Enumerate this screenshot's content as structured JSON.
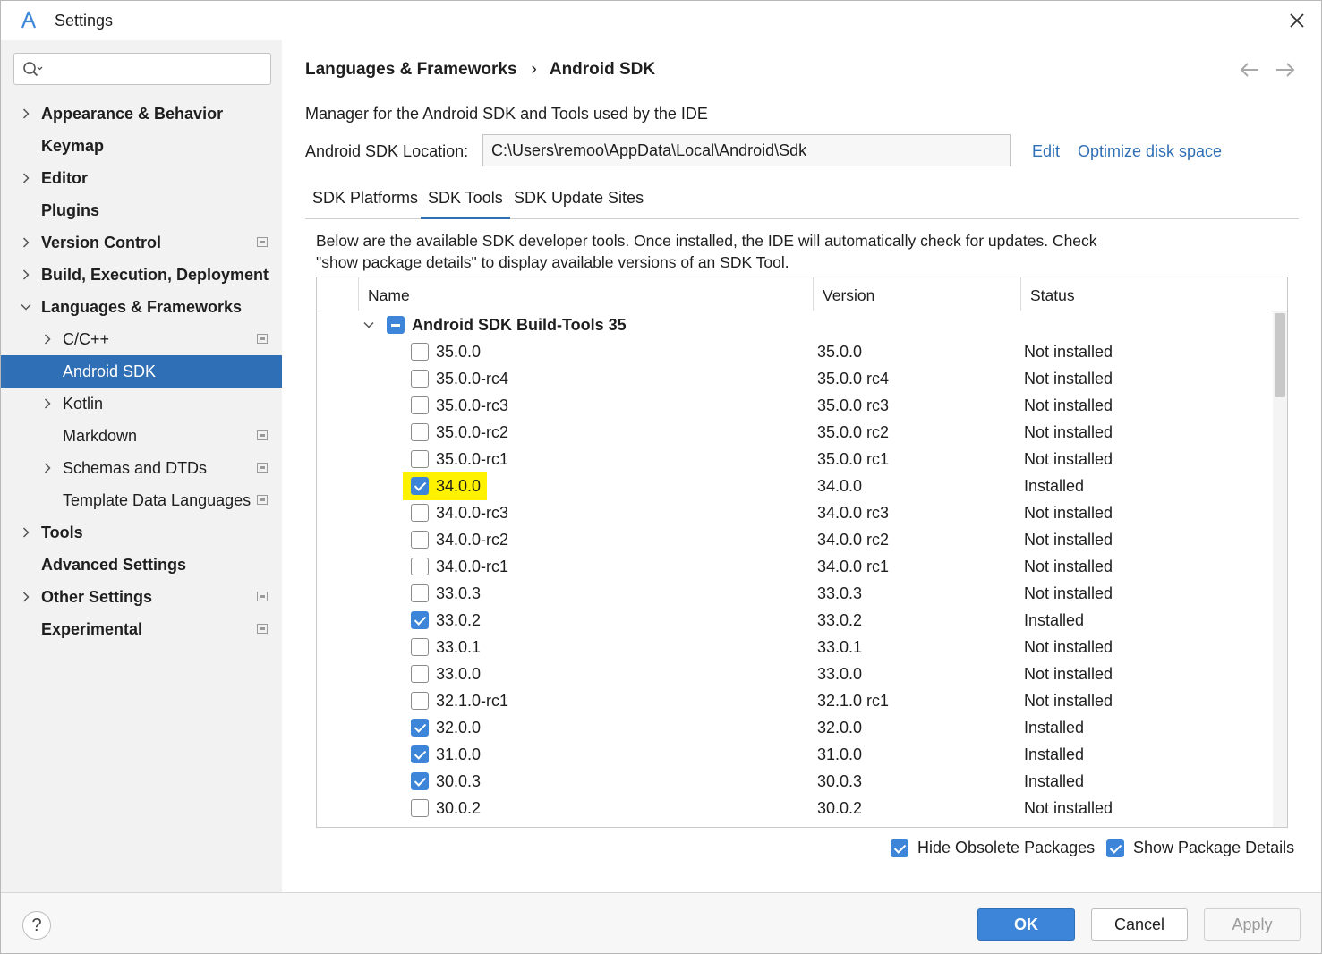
{
  "window": {
    "title": "Settings"
  },
  "search": {
    "placeholder": "",
    "value": ""
  },
  "sidebar": {
    "items": [
      {
        "label": "Appearance & Behavior",
        "bold": true,
        "chevron": "right",
        "level": 0,
        "project": false
      },
      {
        "label": "Keymap",
        "bold": true,
        "chevron": "none",
        "level": 0,
        "project": false
      },
      {
        "label": "Editor",
        "bold": true,
        "chevron": "right",
        "level": 0,
        "project": false
      },
      {
        "label": "Plugins",
        "bold": true,
        "chevron": "none",
        "level": 0,
        "project": false
      },
      {
        "label": "Version Control",
        "bold": true,
        "chevron": "right",
        "level": 0,
        "project": true
      },
      {
        "label": "Build, Execution, Deployment",
        "bold": true,
        "chevron": "right",
        "level": 0,
        "project": false
      },
      {
        "label": "Languages & Frameworks",
        "bold": true,
        "chevron": "down",
        "level": 0,
        "project": false
      },
      {
        "label": "C/C++",
        "bold": false,
        "chevron": "right",
        "level": 1,
        "project": true
      },
      {
        "label": "Android SDK",
        "bold": false,
        "chevron": "none",
        "level": 1,
        "project": false,
        "selected": true
      },
      {
        "label": "Kotlin",
        "bold": false,
        "chevron": "right",
        "level": 1,
        "project": false
      },
      {
        "label": "Markdown",
        "bold": false,
        "chevron": "none",
        "level": 1,
        "project": true
      },
      {
        "label": "Schemas and DTDs",
        "bold": false,
        "chevron": "right",
        "level": 1,
        "project": true
      },
      {
        "label": "Template Data Languages",
        "bold": false,
        "chevron": "none",
        "level": 1,
        "project": true
      },
      {
        "label": "Tools",
        "bold": true,
        "chevron": "right",
        "level": 0,
        "project": false
      },
      {
        "label": "Advanced Settings",
        "bold": true,
        "chevron": "none",
        "level": 0,
        "project": false
      },
      {
        "label": "Other Settings",
        "bold": true,
        "chevron": "right",
        "level": 0,
        "project": true
      },
      {
        "label": "Experimental",
        "bold": true,
        "chevron": "none",
        "level": 0,
        "project": true
      }
    ]
  },
  "main": {
    "breadcrumb": [
      "Languages & Frameworks",
      "Android SDK"
    ],
    "breadcrumb_separator": "›",
    "description": "Manager for the Android SDK and Tools used by the IDE",
    "location_label": "Android SDK Location:",
    "location_value": "C:\\Users\\remoo\\AppData\\Local\\Android\\Sdk",
    "edit_link": "Edit",
    "optimize_link": "Optimize disk space",
    "tabs": [
      {
        "label": "SDK Platforms",
        "active": false
      },
      {
        "label": "SDK Tools",
        "active": true
      },
      {
        "label": "SDK Update Sites",
        "active": false
      }
    ],
    "info_line1": "Below are the available SDK developer tools. Once installed, the IDE will automatically check for updates. Check",
    "info_line2": "\"show package details\" to display available versions of an SDK Tool.",
    "table": {
      "headers": {
        "name": "Name",
        "version": "Version",
        "status": "Status"
      },
      "group": {
        "name": "Android SDK Build-Tools 35",
        "state": "partial"
      },
      "rows": [
        {
          "name": "35.0.0",
          "version": "35.0.0",
          "status": "Not installed",
          "checked": false
        },
        {
          "name": "35.0.0-rc4",
          "version": "35.0.0 rc4",
          "status": "Not installed",
          "checked": false
        },
        {
          "name": "35.0.0-rc3",
          "version": "35.0.0 rc3",
          "status": "Not installed",
          "checked": false
        },
        {
          "name": "35.0.0-rc2",
          "version": "35.0.0 rc2",
          "status": "Not installed",
          "checked": false
        },
        {
          "name": "35.0.0-rc1",
          "version": "35.0.0 rc1",
          "status": "Not installed",
          "checked": false
        },
        {
          "name": "34.0.0",
          "version": "34.0.0",
          "status": "Installed",
          "checked": true,
          "highlighted": true
        },
        {
          "name": "34.0.0-rc3",
          "version": "34.0.0 rc3",
          "status": "Not installed",
          "checked": false
        },
        {
          "name": "34.0.0-rc2",
          "version": "34.0.0 rc2",
          "status": "Not installed",
          "checked": false
        },
        {
          "name": "34.0.0-rc1",
          "version": "34.0.0 rc1",
          "status": "Not installed",
          "checked": false
        },
        {
          "name": "33.0.3",
          "version": "33.0.3",
          "status": "Not installed",
          "checked": false
        },
        {
          "name": "33.0.2",
          "version": "33.0.2",
          "status": "Installed",
          "checked": true
        },
        {
          "name": "33.0.1",
          "version": "33.0.1",
          "status": "Not installed",
          "checked": false
        },
        {
          "name": "33.0.0",
          "version": "33.0.0",
          "status": "Not installed",
          "checked": false
        },
        {
          "name": "32.1.0-rc1",
          "version": "32.1.0 rc1",
          "status": "Not installed",
          "checked": false
        },
        {
          "name": "32.0.0",
          "version": "32.0.0",
          "status": "Installed",
          "checked": true
        },
        {
          "name": "31.0.0",
          "version": "31.0.0",
          "status": "Installed",
          "checked": true
        },
        {
          "name": "30.0.3",
          "version": "30.0.3",
          "status": "Installed",
          "checked": true
        },
        {
          "name": "30.0.2",
          "version": "30.0.2",
          "status": "Not installed",
          "checked": false
        }
      ]
    },
    "hide_obsolete": {
      "label": "Hide Obsolete Packages",
      "checked": true
    },
    "show_details": {
      "label": "Show Package Details",
      "checked": true
    }
  },
  "footer": {
    "help_label": "?",
    "ok_label": "OK",
    "cancel_label": "Cancel",
    "apply_label": "Apply"
  },
  "colors": {
    "accent": "#3d85d8",
    "selection": "#2f6fb5",
    "link": "#2f6fb5",
    "highlight": "#fff200"
  }
}
